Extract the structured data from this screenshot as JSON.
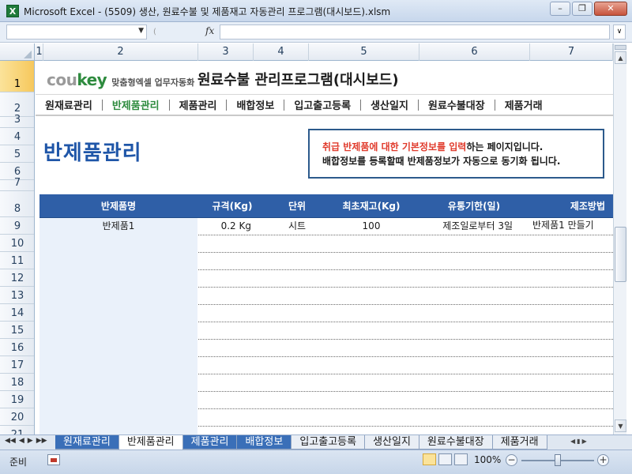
{
  "window": {
    "title": "Microsoft Excel - (5509) 생산, 원료수불 및 제품재고 자동관리 프로그램(대시보드).xlsm",
    "app_icon": "X"
  },
  "formula_bar": {
    "name_box": "",
    "fx_label": "fx",
    "value": ""
  },
  "columns": [
    {
      "label": "1"
    },
    {
      "label": "2"
    },
    {
      "label": "3"
    },
    {
      "label": "4"
    },
    {
      "label": "5"
    },
    {
      "label": "6"
    },
    {
      "label": "7"
    }
  ],
  "rows": [
    "1",
    "2",
    "3",
    "4",
    "5",
    "6",
    "7",
    "8",
    "9",
    "10",
    "11",
    "12",
    "13",
    "14",
    "15",
    "16",
    "17",
    "18",
    "19",
    "20",
    "21"
  ],
  "sheet": {
    "logo_cou": "cou",
    "logo_key": "key",
    "logo_tag": "맞춤형엑셀 업무자동화",
    "app_title": "원료수불 관리프로그램(대시보드)",
    "nav": [
      "원재료관리",
      "반제품관리",
      "제품관리",
      "배합정보",
      "입고출고등록",
      "생산일지",
      "원료수불대장",
      "제품거래"
    ],
    "nav_active": 1,
    "page_heading": "반제품관리",
    "info_line1_red": "취급 반제품에 대한 기본정보를 입력",
    "info_line1_rest": "하는 페이지입니다.",
    "info_line2": "배합정보를 등록할때 반제품정보가 자동으로 동기화 됩니다.",
    "table": {
      "headers": [
        "반제품명",
        "규격(Kg)",
        "단위",
        "최초재고(Kg)",
        "유통기한(일)",
        "제조방법"
      ],
      "rows": [
        [
          "반제품1",
          "0.2 Kg",
          "시트",
          "100",
          "제조일로부터 3일",
          "반제품1 만들기"
        ]
      ],
      "empty_rows": 12
    }
  },
  "sheet_tabs": [
    "원재료관리",
    "반제품관리",
    "제품관리",
    "배합정보",
    "입고출고등록",
    "생산일지",
    "원료수불대장",
    "제품거래"
  ],
  "sheet_tabs_active": 1,
  "status": {
    "ready": "준비",
    "zoom": "100%"
  },
  "colors": {
    "accent_blue": "#2f5fa7",
    "heading_blue": "#1f56a8",
    "active_green": "#2e8b3e",
    "highlight_red": "#e03a2b"
  }
}
